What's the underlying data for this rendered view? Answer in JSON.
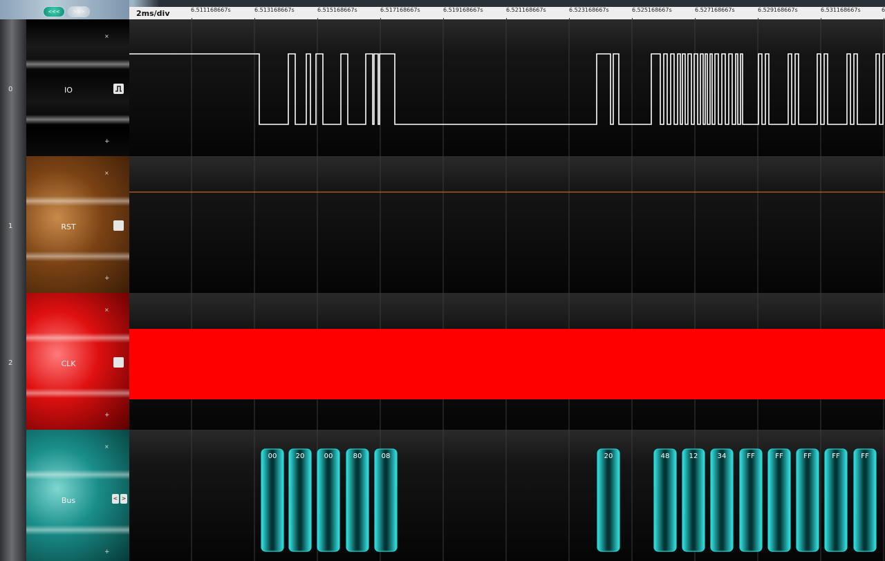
{
  "toolbar": {
    "prev_label": "<<<",
    "next_label": ">>>",
    "scale_label": "2ms/div"
  },
  "ruler": {
    "ticks": [
      "6.511168667s",
      "6.513168667s",
      "6.515168667s",
      "6.517168667s",
      "6.519168667s",
      "6.521168667s",
      "6.523168667s",
      "6.525168667s",
      "6.527168667s",
      "6.529168667s",
      "6.531168667s",
      "6"
    ]
  },
  "channels": [
    {
      "index": "0",
      "name": "IO",
      "remove_label": "×",
      "add_label": "+",
      "icon": "square-wave-icon",
      "color": "#000000"
    },
    {
      "index": "1",
      "name": "RST",
      "remove_label": "×",
      "add_label": "+",
      "icon": "blank-toggle-icon",
      "color": "#8a4a1a"
    },
    {
      "index": "2",
      "name": "CLK",
      "remove_label": "×",
      "add_label": "+",
      "icon": "blank-toggle-icon",
      "color": "#e01010"
    },
    {
      "index": "",
      "name": "Bus",
      "remove_label": "×",
      "add_label": "+",
      "icon": "left-right-icon",
      "color": "#1a8f8a"
    }
  ],
  "bus": {
    "left_label": "<",
    "right_label": ">",
    "packets": [
      "00",
      "20",
      "00",
      "80",
      "08",
      "20",
      "48",
      "12",
      "34",
      "FF",
      "FF",
      "FF",
      "FF",
      "FF"
    ]
  },
  "colors": {
    "io_trace": "#ffffff",
    "rst_trace": "#c8641a",
    "clk_fill": "#ff0000",
    "bus_packet": "#22d3d3"
  }
}
